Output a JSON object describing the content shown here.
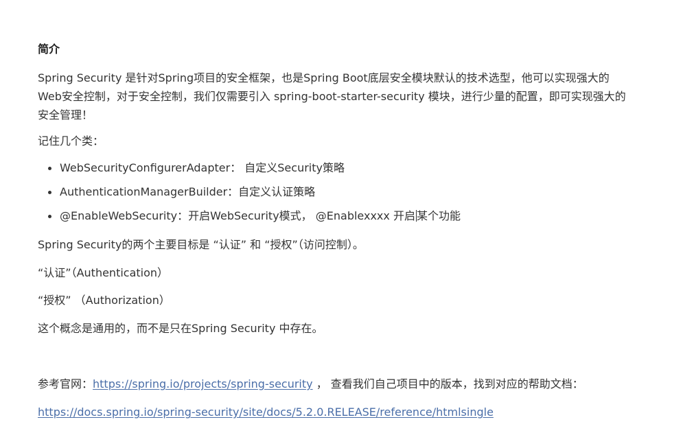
{
  "heading": "简介",
  "intro": "Spring Security 是针对Spring项目的安全框架，也是Spring Boot底层安全模块默认的技术选型，他可以实现强大的Web安全控制，对于安全控制，我们仅需要引入 spring-boot-starter-security 模块，进行少量的配置，即可实现强大的安全管理！",
  "remember_label": "记住几个类：",
  "classes": [
    "WebSecurityConfigurerAdapter： 自定义Security策略",
    "AuthenticationManagerBuilder：自定义认证策略"
  ],
  "enable_item": {
    "part1": "@EnableWebSecurity：开启WebSecurity模式，   @Enablexxxx 开启",
    "part2": "某个功能"
  },
  "goals": "Spring Security的两个主要目标是 “认证” 和 “授权”（访问控制）。",
  "authentication": "“认证”（Authentication）",
  "authorization": "“授权” （Authorization）",
  "general": "这个概念是通用的，而不是只在Spring Security 中存在。",
  "reference": {
    "prefix": "参考官网：",
    "link": "https://spring.io/projects/spring-security",
    "suffix": " ，  查看我们自己项目中的版本，找到对应的帮助文档："
  },
  "docs_link": "https://docs.spring.io/spring-security/site/docs/5.2.0.RELEASE/reference/htmlsingle"
}
